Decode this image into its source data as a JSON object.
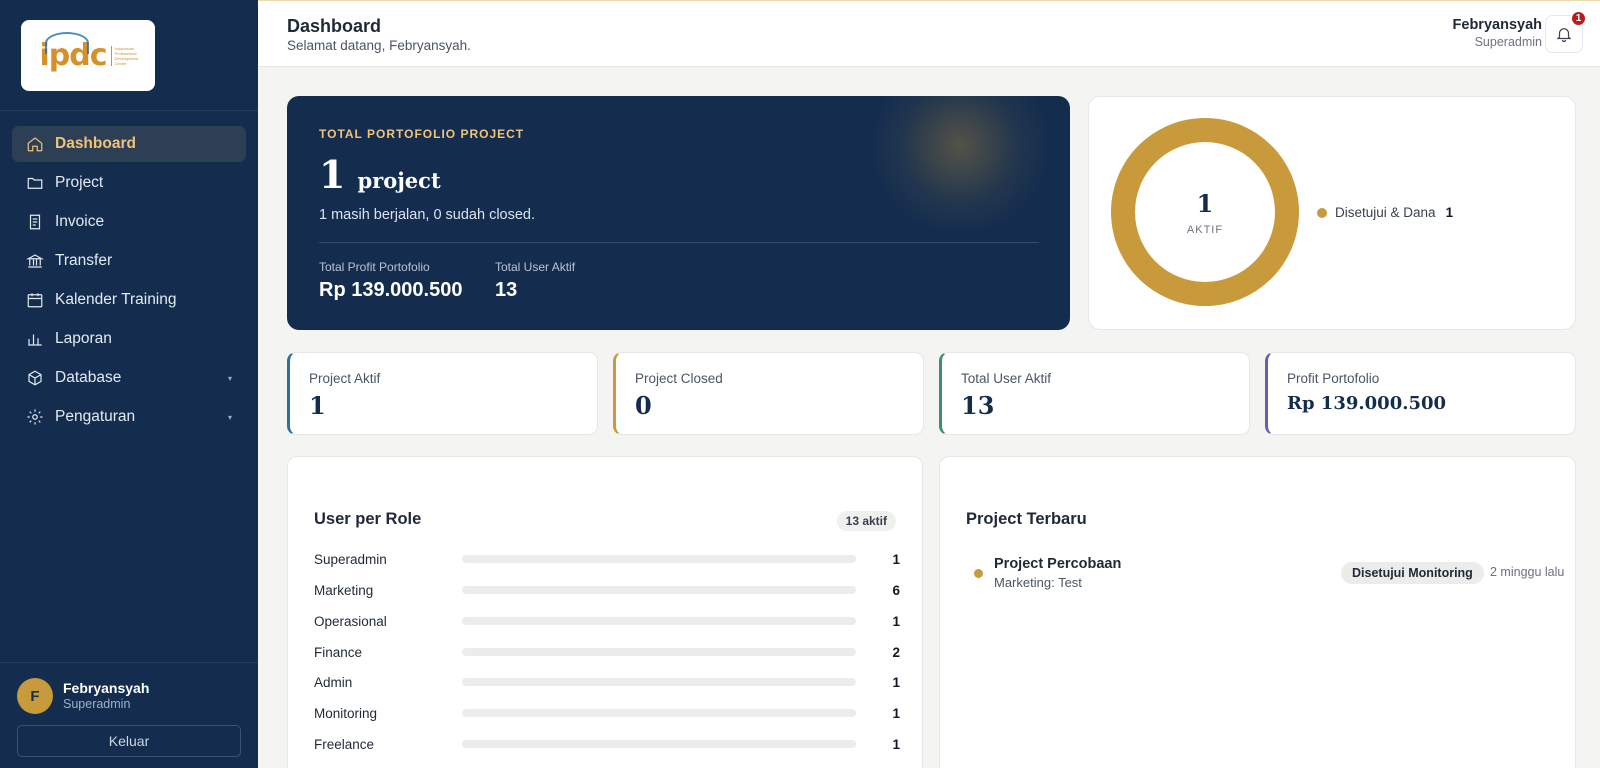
{
  "brand": {
    "logo_text": "ipdc",
    "logo_subtitle": "Indonesian Professional Development Centre",
    "logo_tagline": "TRAINING INSTITUTE"
  },
  "sidebar": {
    "items": [
      {
        "label": "Dashboard",
        "icon": "home-icon",
        "active": true
      },
      {
        "label": "Project",
        "icon": "folder-icon"
      },
      {
        "label": "Invoice",
        "icon": "document-icon"
      },
      {
        "label": "Transfer",
        "icon": "bank-icon"
      },
      {
        "label": "Kalender Training",
        "icon": "calendar-icon"
      },
      {
        "label": "Laporan",
        "icon": "bar-chart-icon"
      },
      {
        "label": "Database",
        "icon": "cube-icon",
        "has_submenu": true
      },
      {
        "label": "Pengaturan",
        "icon": "gear-icon",
        "has_submenu": true
      }
    ],
    "user": {
      "initial": "F",
      "name": "Febryansyah",
      "role": "Superadmin"
    },
    "logout_label": "Keluar"
  },
  "header": {
    "title": "Dashboard",
    "subtitle": "Selamat datang, Febryansyah.",
    "user_name": "Febryansyah",
    "user_role": "Superadmin",
    "notification_count": "1"
  },
  "hero": {
    "label": "TOTAL PORTOFOLIO PROJECT",
    "number": "1",
    "unit": "project",
    "note": "1 masih berjalan, 0 sudah closed.",
    "stat1_label": "Total Profit Portofolio",
    "stat1_value": "Rp 139.000.500",
    "stat2_label": "Total User Aktif",
    "stat2_value": "13"
  },
  "donut": {
    "center_value": "1",
    "center_label": "AKTIF",
    "legend": [
      {
        "label": "Disetujui & Dana",
        "count": "1",
        "color": "#c99a3b"
      }
    ]
  },
  "stats": [
    {
      "label": "Project Aktif",
      "value": "1",
      "accent": "#2e6fa3"
    },
    {
      "label": "Project Closed",
      "value": "0",
      "accent": "#c99a3b"
    },
    {
      "label": "Total User Aktif",
      "value": "13",
      "accent": "#3f8f6b"
    },
    {
      "label": "Profit Portofolio",
      "value": "Rp 139.000.500",
      "accent": "#6b5bb3"
    }
  ],
  "roles_panel": {
    "title": "User per Role",
    "badge": "13 aktif",
    "rows": [
      {
        "role": "Superadmin",
        "count": "1"
      },
      {
        "role": "Marketing",
        "count": "6"
      },
      {
        "role": "Operasional",
        "count": "1"
      },
      {
        "role": "Finance",
        "count": "2"
      },
      {
        "role": "Admin",
        "count": "1"
      },
      {
        "role": "Monitoring",
        "count": "1"
      },
      {
        "role": "Freelance",
        "count": "1"
      }
    ]
  },
  "projects_panel": {
    "title": "Project Terbaru",
    "items": [
      {
        "name": "Project Percobaan",
        "sub": "Marketing: Test",
        "status": "Disetujui Monitoring",
        "time": "2 minggu lalu"
      }
    ]
  },
  "colors": {
    "sidebar_bg": "#142d4f",
    "accent_gold": "#c99a3b",
    "active_text": "#f1c27a"
  }
}
